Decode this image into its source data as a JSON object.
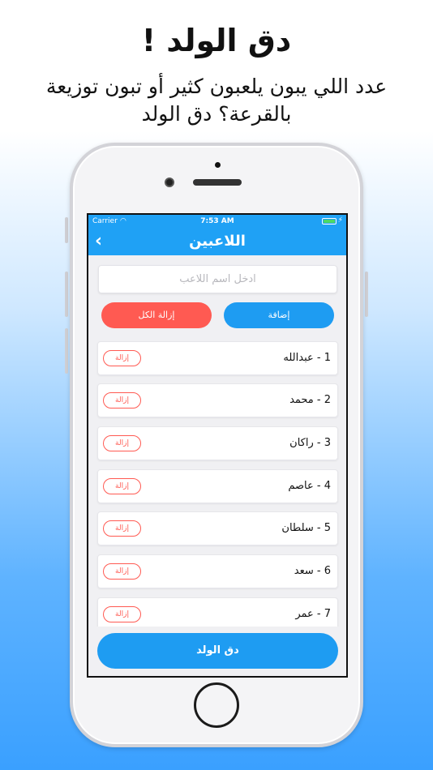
{
  "promo": {
    "title": "دق الولد !",
    "subtitle": "عدد اللي يبون يلعبون كثير أو تبون توزيعة بالقرعة؟ دق الولد"
  },
  "status_bar": {
    "carrier": "Carrier",
    "time": "7:53 AM"
  },
  "nav": {
    "back": "‹",
    "title": "اللاعبين"
  },
  "input": {
    "placeholder": "ادخل اسم اللاعب",
    "value": ""
  },
  "buttons": {
    "add": "إضافة",
    "remove_all": "إزالة الكل",
    "draw": "دق الولد"
  },
  "players": [
    {
      "label": "1 - عبدالله",
      "remove": "إزالة"
    },
    {
      "label": "2 - محمد",
      "remove": "إزالة"
    },
    {
      "label": "3 - راكان",
      "remove": "إزالة"
    },
    {
      "label": "4 - عاصم",
      "remove": "إزالة"
    },
    {
      "label": "5 - سلطان",
      "remove": "إزالة"
    },
    {
      "label": "6 - سعد",
      "remove": "إزالة"
    },
    {
      "label": "7 - عمر",
      "remove": "إزالة"
    }
  ],
  "colors": {
    "primary": "#1e9cf2",
    "danger": "#ff5a52",
    "battery": "#4cd964"
  },
  "icons": [
    "wifi-icon",
    "battery-icon",
    "charging-bolt-icon",
    "back-chevron-icon"
  ]
}
